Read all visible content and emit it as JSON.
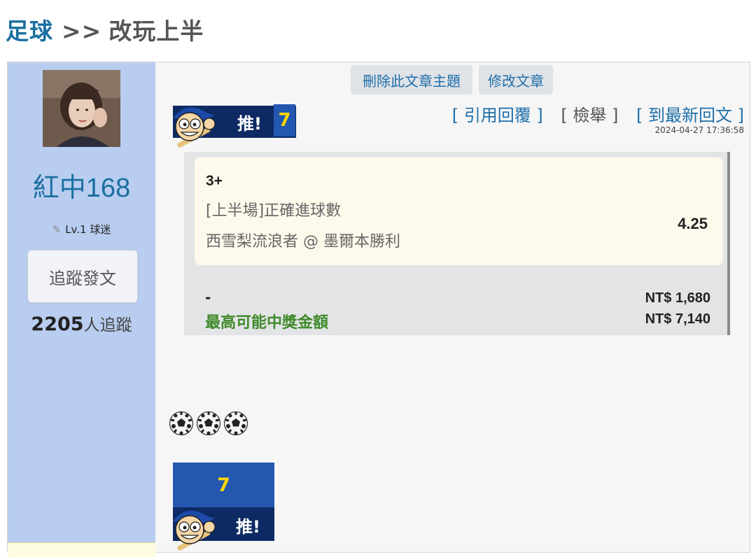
{
  "breadcrumb": {
    "category": "足球",
    "separator": ">>",
    "title": "改玩上半"
  },
  "author": {
    "name": "紅中168",
    "level": "Lv.1 球迷",
    "follow_button": "追蹤發文",
    "followers_count": "2205",
    "followers_suffix": "人追蹤"
  },
  "admin": {
    "delete_topic": "刪除此文章主題",
    "edit_post": "修改文章"
  },
  "push": {
    "label": "推!",
    "count": "7"
  },
  "post_links": {
    "quote": "[ 引用回覆 ]",
    "report": "[ 檢舉 ]",
    "latest": "[ 到最新回文 ]"
  },
  "timestamp": "2024-04-27 17:36:58",
  "bet": {
    "pick": "3+",
    "market": "[上半場]正確進球數",
    "match": "西雪梨流浪者 @ 墨爾本勝利",
    "odds": "4.25",
    "stake_label": "-",
    "stake_amount": "NT$ 1,680",
    "max_win_label": "最高可能中獎金額",
    "max_win_amount": "NT$ 7,140"
  },
  "content": {
    "emoji_count": 3,
    "emoji_icon": "soccer-ball-icon"
  },
  "colors": {
    "sidebar": "#b9cdf0",
    "link": "#1f6faa",
    "badge_dark": "#0d2a63",
    "badge_blue": "#2357b0",
    "push_number": "#ffd600",
    "win_label": "#3f8a2b"
  }
}
